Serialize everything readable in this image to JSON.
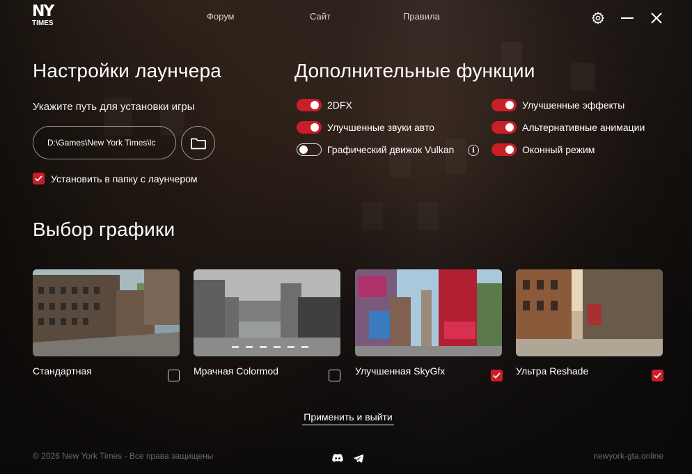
{
  "logo": {
    "top": "NY",
    "bottom": "TIMES"
  },
  "nav": {
    "forum": "Форум",
    "site": "Сайт",
    "rules": "Правила"
  },
  "icons": {
    "settings": "gear-icon",
    "minimize": "minimize-icon",
    "close": "close-icon",
    "folder": "folder-icon",
    "discord": "discord-icon",
    "telegram": "telegram-icon",
    "info": "info-icon",
    "check": "check-icon"
  },
  "launcher": {
    "title": "Настройки лаунчера",
    "path_label": "Укажите путь для установки игры",
    "path_value": "D:\\Games\\New York Times\\lc",
    "install_in_folder": {
      "label": "Установить в папку с лаунчером",
      "checked": true
    }
  },
  "extra": {
    "title": "Дополнительные функции",
    "toggles": [
      {
        "label": "2DFX",
        "on": true
      },
      {
        "label": "Улучшенные звуки авто",
        "on": true
      },
      {
        "label": "Графический движок Vulkan",
        "on": false
      },
      {
        "label": "Улучшенные эффекты",
        "on": true
      },
      {
        "label": "Альтернативные анимации",
        "on": true
      },
      {
        "label": "Оконный режим",
        "on": true
      }
    ]
  },
  "graphics": {
    "title": "Выбор графики",
    "options": [
      {
        "title": "Стандартная",
        "checked": false
      },
      {
        "title": "Мрачная Colormod",
        "checked": false
      },
      {
        "title": "Улучшенная SkyGfx",
        "checked": true
      },
      {
        "title": "Ультра Reshade",
        "checked": true
      }
    ]
  },
  "apply_label": "Применить и выйти",
  "footer": {
    "copyright": "© 2026 New York Times - Все права защищены",
    "site": "newyork-gta.online"
  },
  "colors": {
    "accent": "#c81f28",
    "background": "#0d0c0c"
  }
}
